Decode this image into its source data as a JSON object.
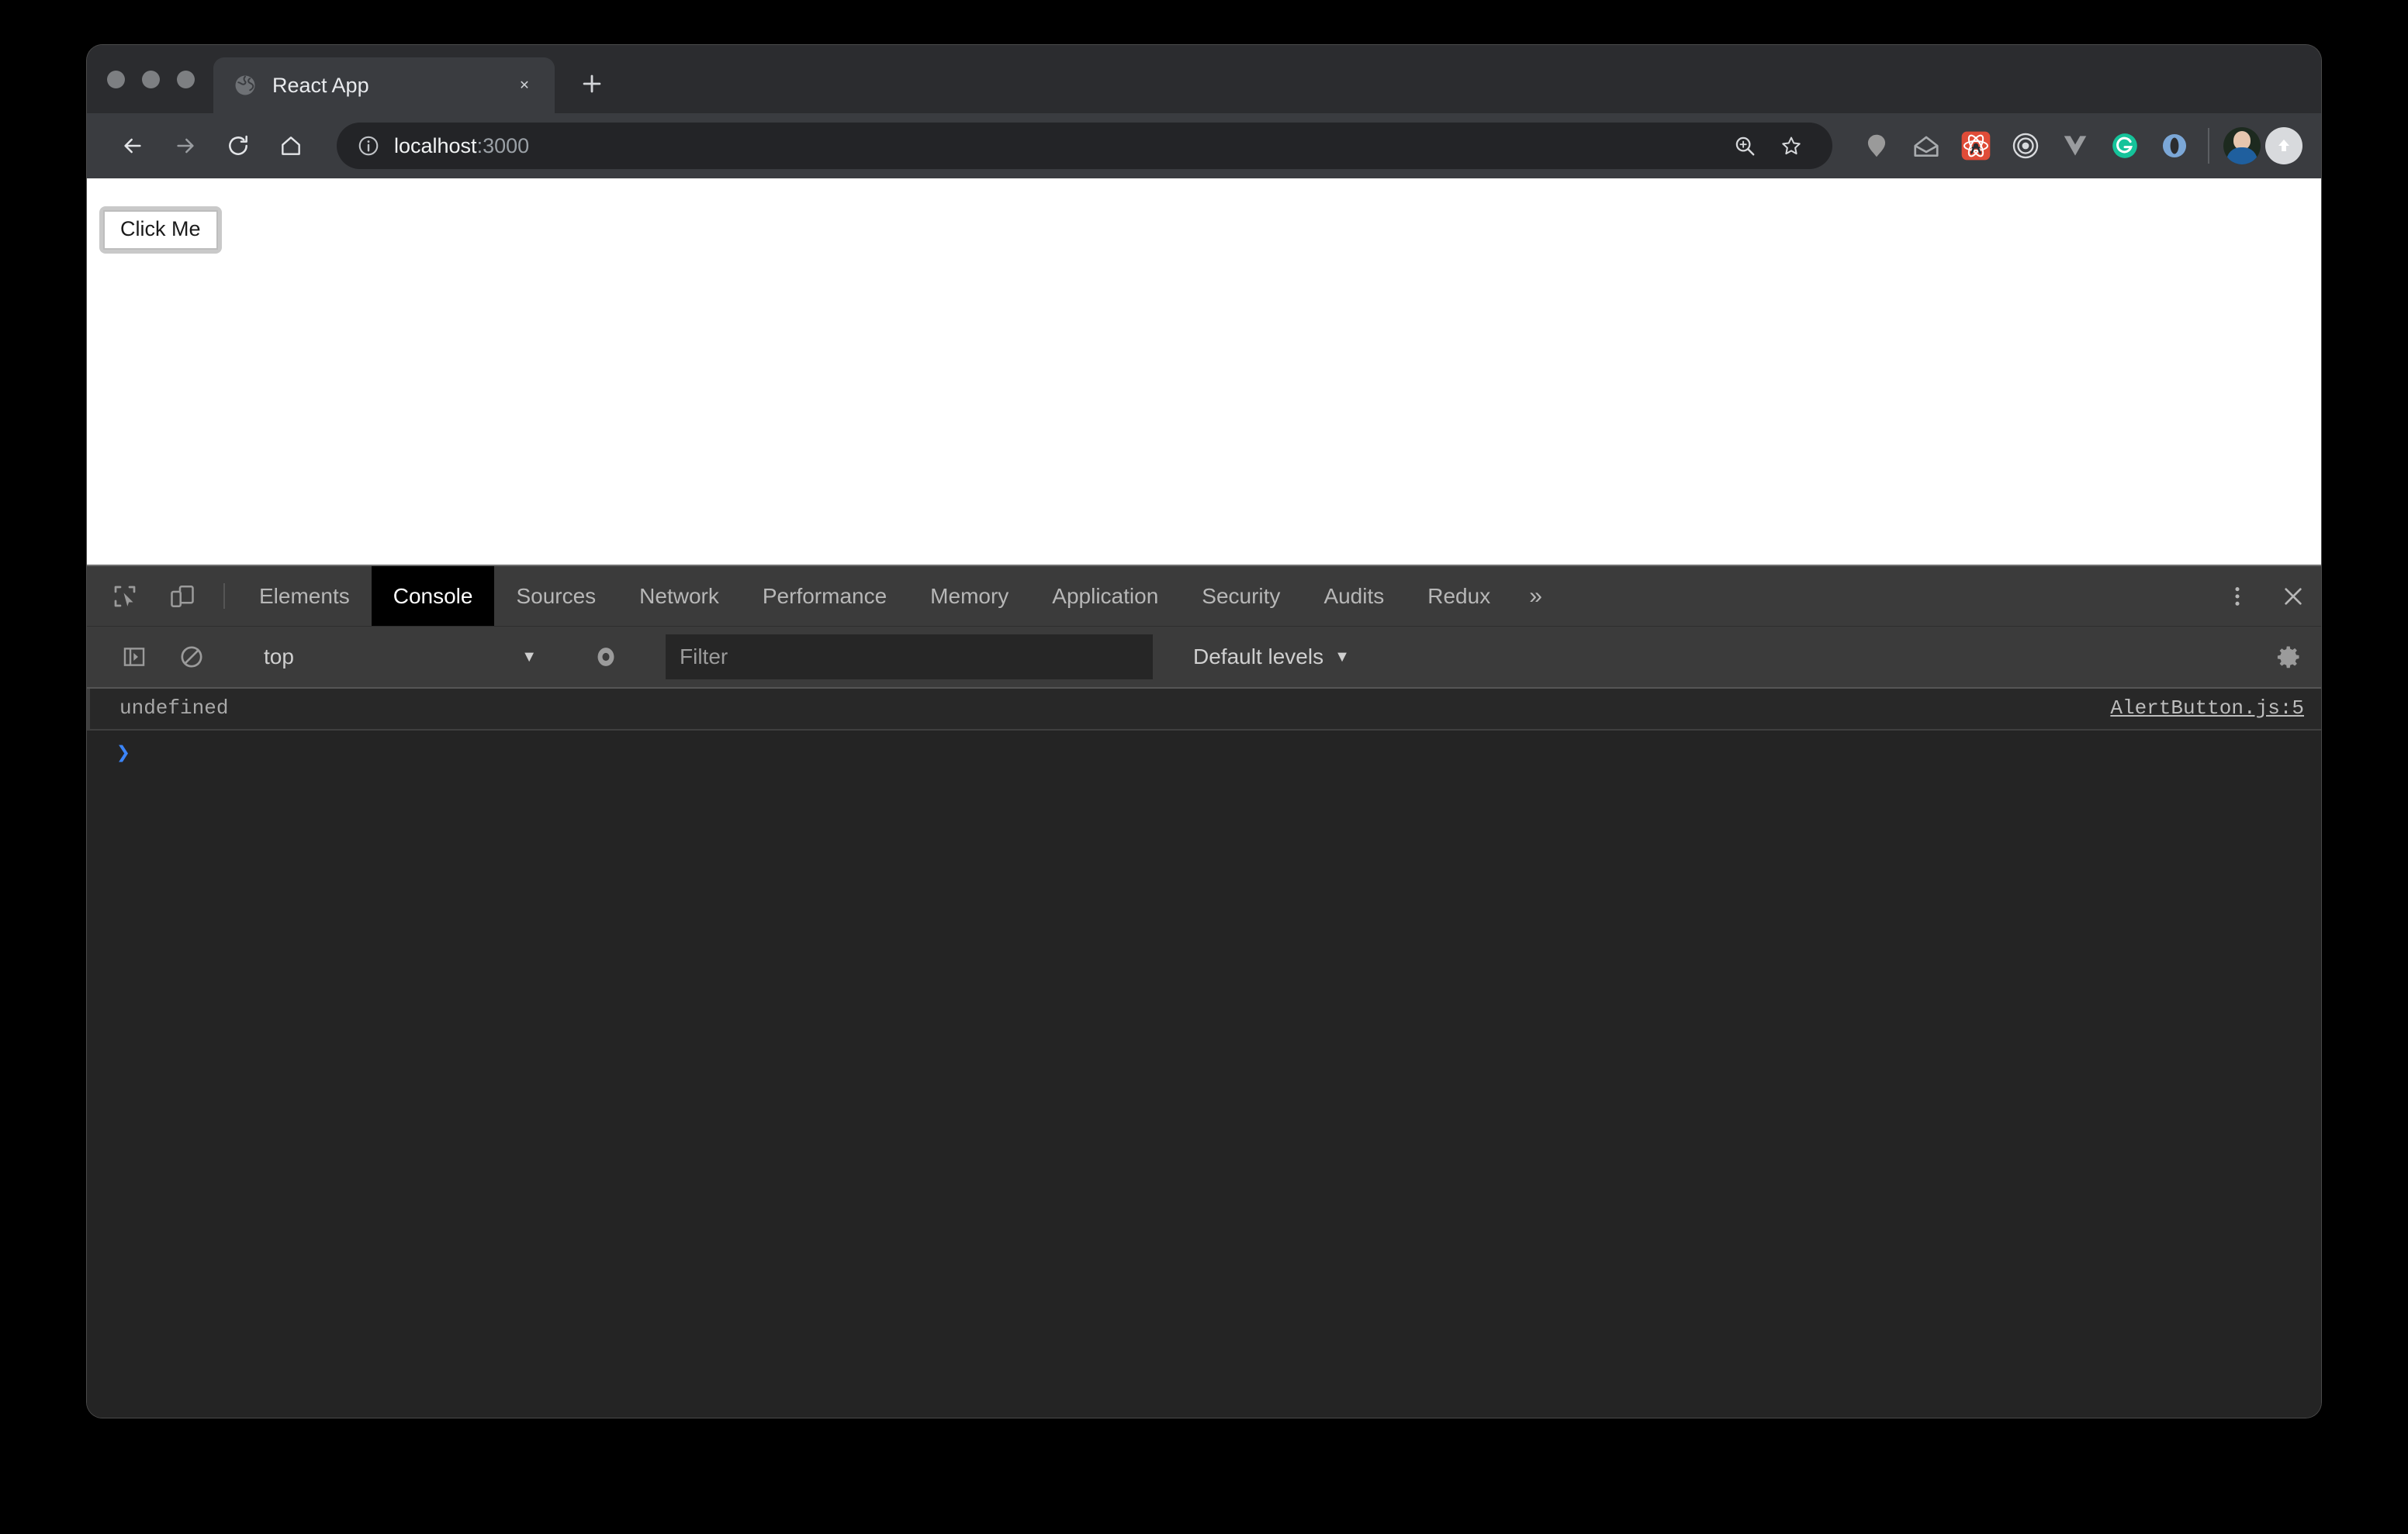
{
  "window": {
    "traffic_lights": [
      "close",
      "minimize",
      "maximize"
    ]
  },
  "tab": {
    "favicon": "globe-icon",
    "title": "React App",
    "close_label": "✕",
    "newtab_label": "+"
  },
  "toolbar": {
    "back_label": "←",
    "forward_label": "→",
    "reload_label": "↻",
    "home_label": "⌂",
    "url_main": "localhost",
    "url_suffix": ":3000",
    "site_info_icon": "info-circle-icon",
    "zoom_icon": "zoom-search-icon",
    "bookmark_icon": "star-icon",
    "extensions": [
      {
        "name": "pin-blob-icon",
        "color": "#9a9a9a"
      },
      {
        "name": "inbox-envelope-icon",
        "color": "#a8abae"
      },
      {
        "name": "react-devtools-icon",
        "color": "#e04c38"
      },
      {
        "name": "target-circles-icon",
        "color": "#d8dadd"
      },
      {
        "name": "vue-chevron-icon",
        "color": "#9a9c9f"
      },
      {
        "name": "grammarly-icon",
        "color": "#15c39a"
      },
      {
        "name": "blue-ring-icon",
        "color": "#7ba7d7"
      }
    ],
    "avatar": "profile-avatar",
    "upload_icon": "upload-arrow-icon"
  },
  "page": {
    "button_label": "Click Me"
  },
  "devtools": {
    "inspect_icon": "inspect-element-icon",
    "device_icon": "device-toolbar-icon",
    "tabs": [
      {
        "label": "Elements",
        "active": false
      },
      {
        "label": "Console",
        "active": true
      },
      {
        "label": "Sources",
        "active": false
      },
      {
        "label": "Network",
        "active": false
      },
      {
        "label": "Performance",
        "active": false
      },
      {
        "label": "Memory",
        "active": false
      },
      {
        "label": "Application",
        "active": false
      },
      {
        "label": "Security",
        "active": false
      },
      {
        "label": "Audits",
        "active": false
      },
      {
        "label": "Redux",
        "active": false
      }
    ],
    "overflow_label": "»",
    "menu_icon": "vertical-dots-icon",
    "close_icon": "close-icon",
    "console_toolbar": {
      "sidebar_toggle_icon": "console-sidebar-icon",
      "clear_icon": "clear-console-icon",
      "context": "top",
      "context_caret": "▼",
      "eye_icon": "live-expression-eye-icon",
      "filter_placeholder": "Filter",
      "filter_value": "",
      "levels_label": "Default levels",
      "levels_caret": "▼",
      "settings_icon": "gear-icon"
    },
    "console_entries": [
      {
        "message": "undefined",
        "source": "AlertButton.js:5"
      }
    ],
    "prompt_chevron": "❯"
  }
}
